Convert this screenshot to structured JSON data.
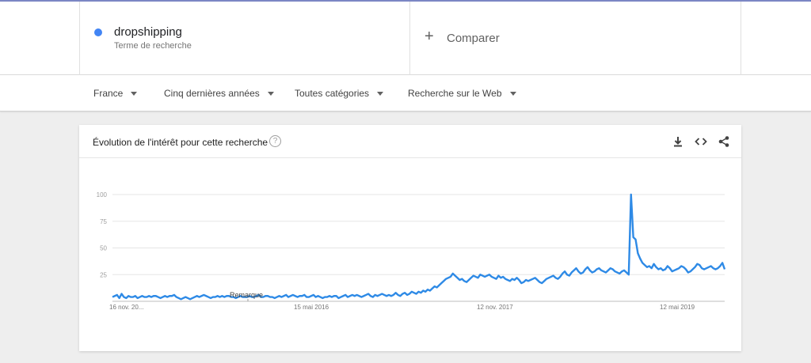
{
  "term": {
    "name": "dropshipping",
    "subtitle": "Terme de recherche",
    "color": "#4285f4"
  },
  "compare": {
    "label": "Comparer"
  },
  "filters": {
    "region": "France",
    "period": "Cinq dernières années",
    "category": "Toutes catégories",
    "search_type": "Recherche sur le Web"
  },
  "card": {
    "title": "Évolution de l'intérêt pour cette recherche",
    "help_glyph": "?",
    "icons": [
      "download-icon",
      "embed-icon",
      "share-icon"
    ]
  },
  "chart_data": {
    "type": "line",
    "title": "",
    "xlabel": "",
    "ylabel": "",
    "ylim": [
      0,
      100
    ],
    "yticks": [
      25,
      50,
      75,
      100
    ],
    "grid": true,
    "line_color": "#2e8ae6",
    "x_tick_labels": [
      "16 nov. 20...",
      "15 mai 2016",
      "12 nov. 2017",
      "12 mai 2019"
    ],
    "annotation": "Remarque",
    "series": [
      {
        "values": [
          4,
          5,
          6,
          3,
          7,
          4,
          3,
          5,
          4,
          4,
          5,
          3,
          4,
          5,
          4,
          4,
          5,
          4,
          5,
          5,
          4,
          3,
          4,
          5,
          4,
          5,
          5,
          6,
          4,
          3,
          2,
          3,
          4,
          3,
          2,
          3,
          4,
          5,
          4,
          5,
          6,
          5,
          4,
          3,
          4,
          4,
          5,
          4,
          5,
          4,
          5,
          5,
          4,
          4,
          3,
          4,
          5,
          4,
          4,
          4,
          5,
          4,
          4,
          5,
          6,
          4,
          4,
          5,
          5,
          4,
          4,
          3,
          4,
          5,
          4,
          5,
          6,
          4,
          5,
          6,
          5,
          4,
          5,
          5,
          6,
          4,
          4,
          5,
          6,
          4,
          5,
          4,
          3,
          4,
          4,
          5,
          4,
          5,
          5,
          3,
          4,
          5,
          6,
          4,
          5,
          6,
          5,
          6,
          5,
          4,
          5,
          6,
          7,
          5,
          4,
          6,
          5,
          6,
          7,
          6,
          5,
          6,
          5,
          6,
          8,
          6,
          5,
          7,
          8,
          6,
          7,
          9,
          8,
          7,
          9,
          8,
          10,
          9,
          11,
          10,
          12,
          14,
          13,
          15,
          17,
          19,
          21,
          22,
          23,
          26,
          24,
          22,
          20,
          21,
          19,
          18,
          20,
          22,
          24,
          23,
          22,
          25,
          24,
          23,
          24,
          25,
          23,
          22,
          21,
          24,
          22,
          23,
          21,
          20,
          19,
          21,
          20,
          22,
          20,
          17,
          18,
          20,
          19,
          20,
          21,
          22,
          20,
          18,
          17,
          19,
          21,
          22,
          23,
          24,
          22,
          21,
          23,
          26,
          28,
          25,
          24,
          27,
          29,
          31,
          28,
          26,
          27,
          30,
          32,
          29,
          27,
          28,
          30,
          31,
          29,
          28,
          27,
          29,
          31,
          30,
          28,
          27,
          26,
          28,
          29,
          27,
          25,
          100,
          60,
          58,
          45,
          40,
          36,
          34,
          32,
          33,
          31,
          35,
          32,
          30,
          31,
          29,
          30,
          33,
          31,
          28,
          29,
          30,
          31,
          33,
          32,
          30,
          27,
          28,
          30,
          32,
          35,
          34,
          31,
          30,
          31,
          32,
          33,
          31,
          30,
          31,
          33,
          36,
          30
        ]
      }
    ]
  }
}
